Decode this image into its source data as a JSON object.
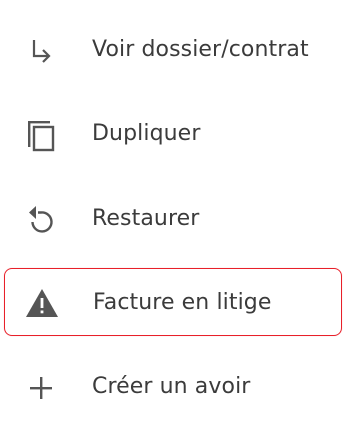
{
  "context_menu": {
    "items": [
      {
        "label": "Voir dossier/contrat",
        "icon": "subdirectory-arrow-right-icon"
      },
      {
        "label": "Dupliquer",
        "icon": "copy-icon"
      },
      {
        "label": "Restaurer",
        "icon": "restore-icon"
      },
      {
        "label": "Facture en litige",
        "icon": "warning-icon",
        "highlighted": true
      },
      {
        "label": "Créer un avoir",
        "icon": "plus-icon"
      }
    ],
    "colors": {
      "text": "#3b3b3b",
      "icon": "#555555",
      "highlight_border": "#e8202a"
    }
  }
}
